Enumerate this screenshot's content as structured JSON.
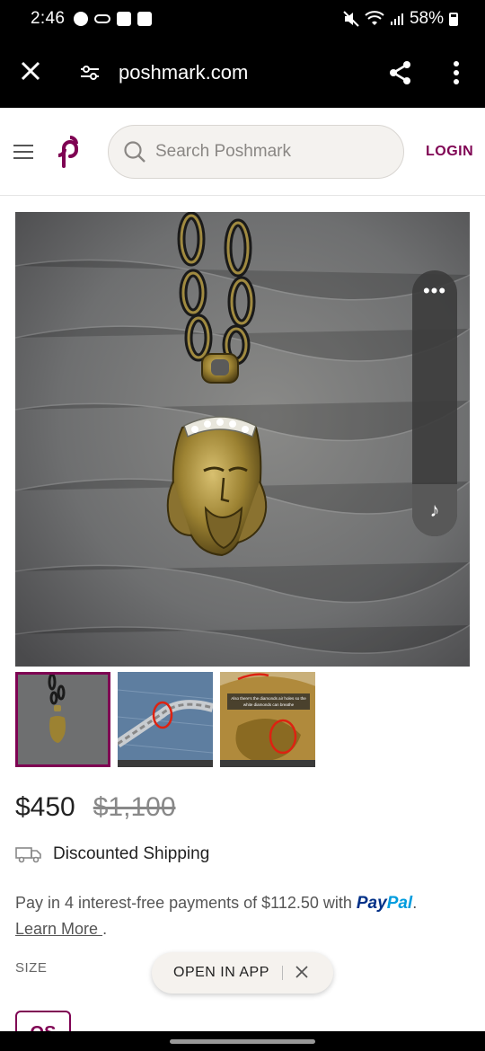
{
  "status_bar": {
    "time": "2:46",
    "battery": "58%",
    "icons": [
      "facebook-icon",
      "voicemail-icon",
      "square-app-icon",
      "image-icon",
      "mute-icon",
      "wifi-icon",
      "signal-icon",
      "battery-icon"
    ]
  },
  "browser": {
    "url": "poshmark.com",
    "icons": [
      "close-icon",
      "tune-icon",
      "share-icon",
      "more-vertical-icon"
    ]
  },
  "header": {
    "search_placeholder": "Search Poshmark",
    "login_label": "LOGIN",
    "brand_color": "#7f0353"
  },
  "listing": {
    "price": "$450",
    "original_price": "$1,100",
    "shipping_label": "Discounted Shipping",
    "paypal": {
      "text_before": "Pay in 4 interest-free payments of $112.50 with ",
      "logo_pay": "Pay",
      "logo_pal": "Pal",
      "text_after": ".",
      "learn_more": "Learn More ",
      "learn_more_suffix": "."
    },
    "size_label": "SIZE",
    "size_value": "OS",
    "thumbnails": [
      "pendant-photo",
      "chain-clasp-photo",
      "pendant-back-photo"
    ],
    "thumb_caption": "Also there's the diamonds air holes so the white diamonds can breathe",
    "selected_thumb": 0
  },
  "floating": {
    "open_app_label": "OPEN IN APP"
  }
}
